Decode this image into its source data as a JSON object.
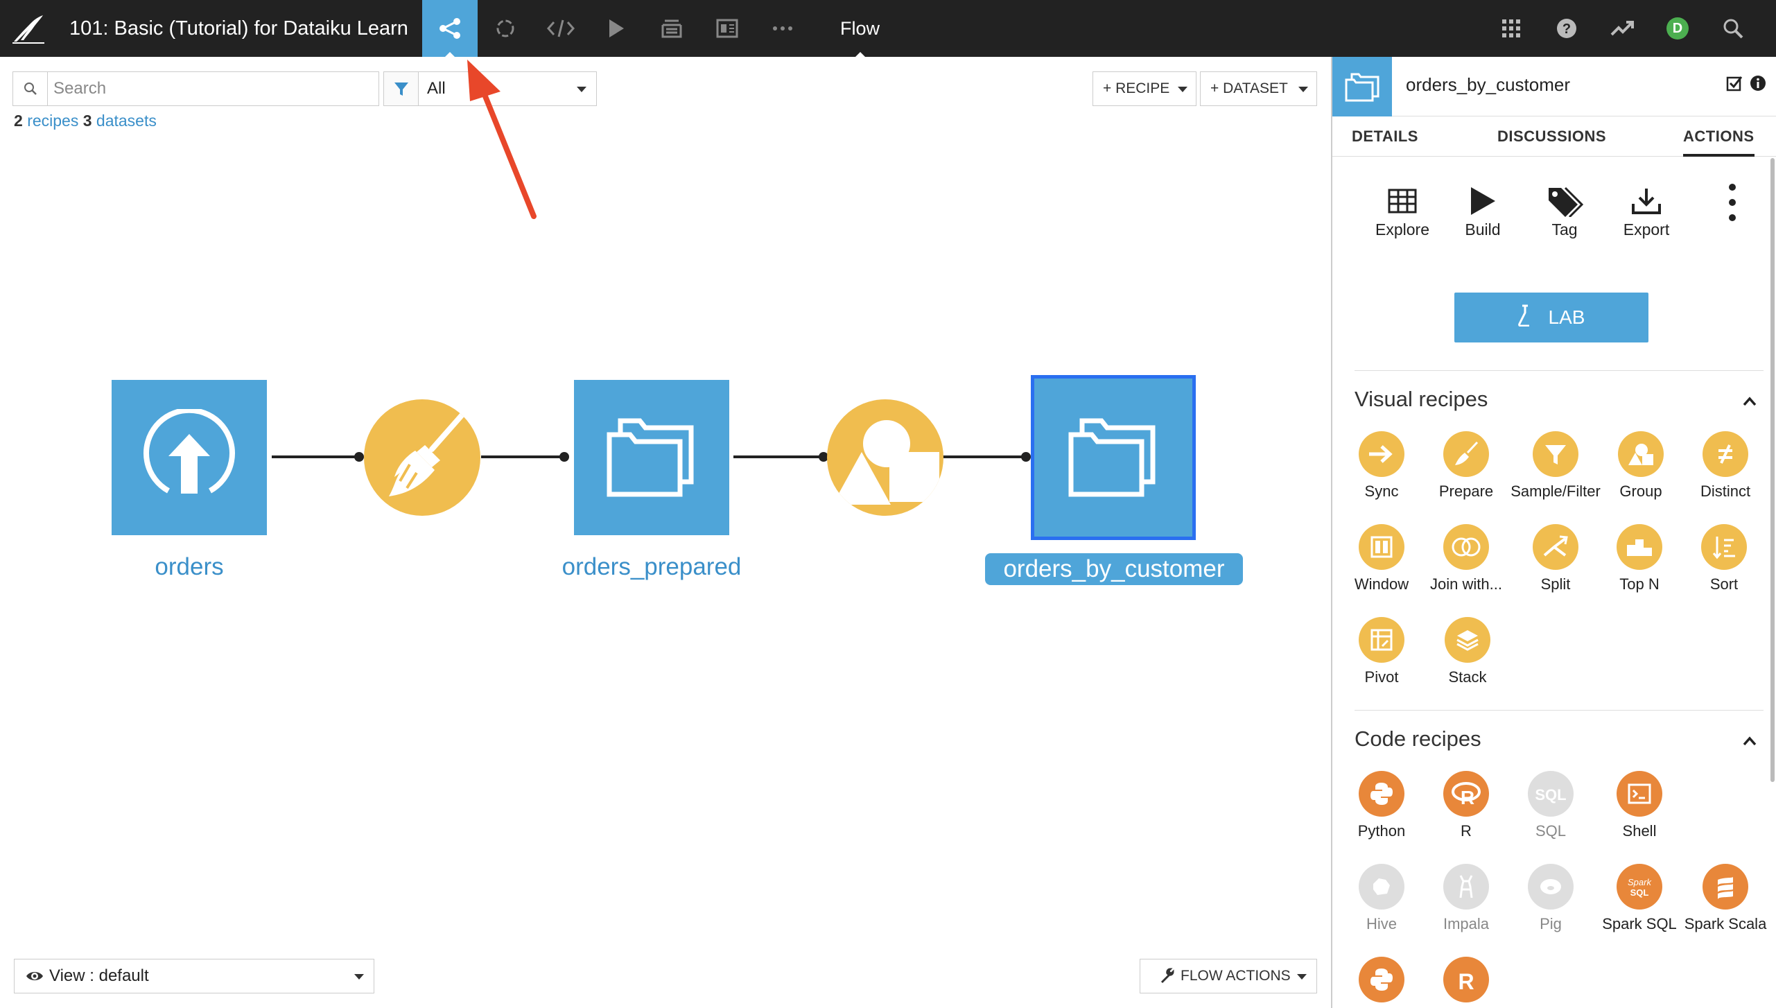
{
  "header": {
    "project_title": "101: Basic (Tutorial) for Dataiku Learn",
    "active_section": "Flow",
    "avatar_initial": "D",
    "nav_icons": [
      "flow-icon",
      "jobs-icon",
      "code-icon",
      "run-icon",
      "notebooks-icon",
      "dashboard-icon",
      "more-icon"
    ],
    "right_icons": [
      "apps-grid-icon",
      "help-icon",
      "trending-icon",
      "avatar",
      "search-icon"
    ]
  },
  "toolbar": {
    "search_placeholder": "Search",
    "filter_value": "All",
    "recipe_button": "+ RECIPE",
    "dataset_button": "+ DATASET",
    "recipes_count": "2",
    "recipes_label": "recipes",
    "datasets_count": "3",
    "datasets_label": "datasets"
  },
  "flow": {
    "nodes": [
      {
        "type": "dataset",
        "name": "orders",
        "icon": "upload-icon"
      },
      {
        "type": "recipe",
        "name": "prepare",
        "icon": "broom-icon"
      },
      {
        "type": "dataset",
        "name": "orders_prepared",
        "icon": "folder-icon"
      },
      {
        "type": "recipe",
        "name": "group",
        "icon": "group-shapes-icon"
      },
      {
        "type": "dataset",
        "name": "orders_by_customer",
        "icon": "folder-icon",
        "selected": true
      }
    ]
  },
  "bottom": {
    "view_label": "View : default",
    "flow_actions_label": "FLOW ACTIONS"
  },
  "panel": {
    "title": "orders_by_customer",
    "tabs": [
      "DETAILS",
      "DISCUSSIONS",
      "ACTIONS"
    ],
    "active_tab": "ACTIONS",
    "actions": [
      "Explore",
      "Build",
      "Tag",
      "Export"
    ],
    "lab_label": "LAB",
    "visual_recipes_title": "Visual recipes",
    "visual_recipes": [
      "Sync",
      "Prepare",
      "Sample/Filter",
      "Group",
      "Distinct",
      "Window",
      "Join with...",
      "Split",
      "Top N",
      "Sort",
      "Pivot",
      "Stack"
    ],
    "code_recipes_title": "Code recipes",
    "code_recipes": [
      "Python",
      "R",
      "SQL",
      "Shell",
      "Hive",
      "Impala",
      "Pig",
      "Spark SQL",
      "Spark Scala"
    ],
    "colors": {
      "recipe_visual": "#f0bd4f",
      "recipe_code": "#e8873a",
      "dataset": "#4fa5d9",
      "disabled": "#dedede"
    }
  }
}
